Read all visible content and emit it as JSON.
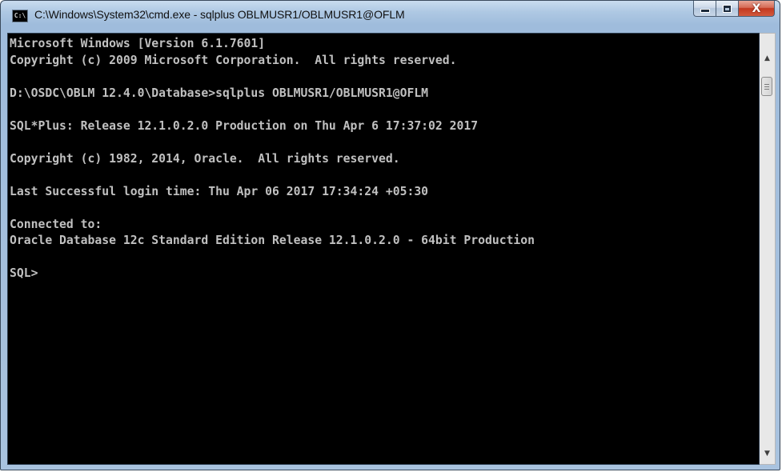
{
  "window": {
    "title": "C:\\Windows\\System32\\cmd.exe - sqlplus  OBLMUSR1/OBLMUSR1@OFLM",
    "icon": "console-app-icon",
    "icon_glyph": "C:\\"
  },
  "caption_buttons": {
    "minimize": "minimize-icon",
    "maximize": "maximize-icon",
    "close": "close-icon",
    "close_glyph": "X"
  },
  "console": {
    "background_color": "#000000",
    "text_color": "#c0c0c0",
    "lines": [
      "Microsoft Windows [Version 6.1.7601]",
      "Copyright (c) 2009 Microsoft Corporation.  All rights reserved.",
      "",
      "D:\\OSDC\\OBLM 12.4.0\\Database>sqlplus OBLMUSR1/OBLMUSR1@OFLM",
      "",
      "SQL*Plus: Release 12.1.0.2.0 Production on Thu Apr 6 17:37:02 2017",
      "",
      "Copyright (c) 1982, 2014, Oracle.  All rights reserved.",
      "",
      "Last Successful login time: Thu Apr 06 2017 17:34:24 +05:30",
      "",
      "Connected to:",
      "Oracle Database 12c Standard Edition Release 12.1.0.2.0 - 64bit Production",
      "",
      "SQL>"
    ]
  },
  "scrollbar": {
    "up_arrow": "▲",
    "down_arrow": "▼"
  }
}
